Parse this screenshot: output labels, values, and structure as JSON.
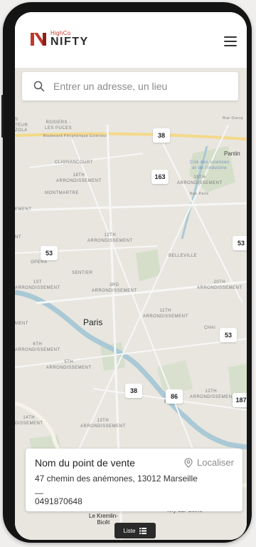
{
  "header": {
    "logo_small": "HighCo",
    "logo_big": "NIFTY",
    "menu_icon": "hamburger-icon"
  },
  "search": {
    "placeholder": "Entrer un adresse, un lieu",
    "icon": "search-icon"
  },
  "map": {
    "labels": {
      "rosiers": "ROSIERS -\nLES PUCES",
      "saint_ouen": "S\nTEUR\nZOLA",
      "boulevard": "Boulevard Périphérique Extérieur",
      "pantin": "Pantin",
      "clignancourt": "CLIGNANCOURT",
      "arr18": "18TH\nARRONDISSEMENT",
      "montmartre": "MONTMARTRE",
      "cite_sciences": "Cité des sciences\net de l'industrie",
      "arr19": "19TH\nARRONDISSEMENT",
      "rue_paris": "Rue Paris",
      "rue_ourcq": "Rue Ourcq",
      "arr17_part": "EMENT",
      "arr17_nt": "NT",
      "arr12": "12TH\nARRONDISSEMENT",
      "belleville": "BELLEVILLE",
      "opera": "OPERA",
      "sentier": "SENTIER",
      "arr1": "1ST\nARRONDISSEMENT",
      "arr3": "3RD\nARRONDISSEMENT",
      "arr20": "20TH\nARRONDISSEMENT",
      "arr11": "11TH\nARRONDISSEMENT",
      "paris": "Paris",
      "ment": "MENT",
      "chai": "CHAI",
      "arr6": "6TH\nARRONDISSEMENT",
      "arr5": "5TH\nARRONDISSEMENT",
      "arr12b": "12TH\nARRONDISSEMEN",
      "bercy": "BERCY",
      "arr14": "14TH\nDISSEMENT",
      "arr13": "13TH\nARRONDISSEMENT",
      "kremlin": "Le Kremlin-\nBicêt",
      "ivry": "Ivry-sur-Seine",
      "right_e": "e",
      "right_p": "P"
    },
    "clusters": [
      "38",
      "163",
      "53",
      "53",
      "53",
      "38",
      "86",
      "187"
    ]
  },
  "card": {
    "title": "Nom du point de vente",
    "locate_label": "Localiser",
    "address": "47 chemin des anémones, 13012 Marseille",
    "separator": "—",
    "phone": "0491870648"
  },
  "list_button": {
    "label": "Liste",
    "icon": "list-icon"
  },
  "colors": {
    "brand_red": "#c0392b",
    "map_bg": "#e8e6df",
    "water": "#aac9d6",
    "park": "#cfdcc3"
  }
}
